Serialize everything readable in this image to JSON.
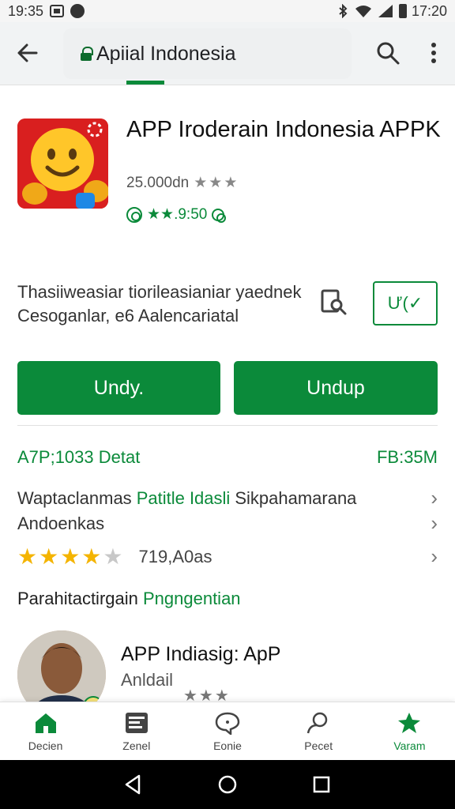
{
  "status_bar": {
    "time_left": "19:35",
    "time_right": "17:20",
    "icons": [
      "notification-square-icon",
      "notification-circle-icon",
      "bluetooth-icon",
      "wifi-icon",
      "signal-icon",
      "battery-icon"
    ]
  },
  "app_bar": {
    "search_text": "Apiial Indonesia",
    "icons": [
      "back-arrow-icon",
      "lock-icon",
      "search-icon",
      "more-vert-icon"
    ]
  },
  "app": {
    "title": "APP Iroderain Indonesia APPK",
    "rating_text": "25.000dn",
    "rating_stars": "★★★",
    "badge_text": "★★.9:50",
    "icon_name": "smiley-face-icon"
  },
  "description": {
    "text": "Thasiiweasiar tiorileasianiar yaednek Cesoganlar, e6 Aalencariatal",
    "wishlist_label": "Ư(✓"
  },
  "buttons": {
    "left": "Undy.",
    "right": "Undup"
  },
  "details": {
    "left": "A7P;1033 Detat",
    "right": "FB:35M",
    "row1_prefix": "Waptaclanmas ",
    "row1_highlight": "Patitle Idasli",
    "row1_suffix": " Sikpahamarana",
    "row2": "Andoenkas",
    "rating_value": 4,
    "rating_count": "719,A0as"
  },
  "section": {
    "prefix": "Parahitactirgain ",
    "highlight": "Pngngentian"
  },
  "review": {
    "title": "APP Indiasig: ApP",
    "subtitle": "Anldail",
    "stars": "★★★"
  },
  "bottom_nav": [
    {
      "label": "Decien",
      "icon": "home-icon",
      "active": false
    },
    {
      "label": "Zenel",
      "icon": "news-icon",
      "active": false
    },
    {
      "label": "Eonie",
      "icon": "chat-icon",
      "active": false
    },
    {
      "label": "Pecet",
      "icon": "search-person-icon",
      "active": false
    },
    {
      "label": "Varam",
      "icon": "star-icon",
      "active": true
    }
  ],
  "colors": {
    "accent": "#0b8a3a",
    "app_icon_bg": "#d91f1f",
    "star_gold": "#f4b400"
  }
}
